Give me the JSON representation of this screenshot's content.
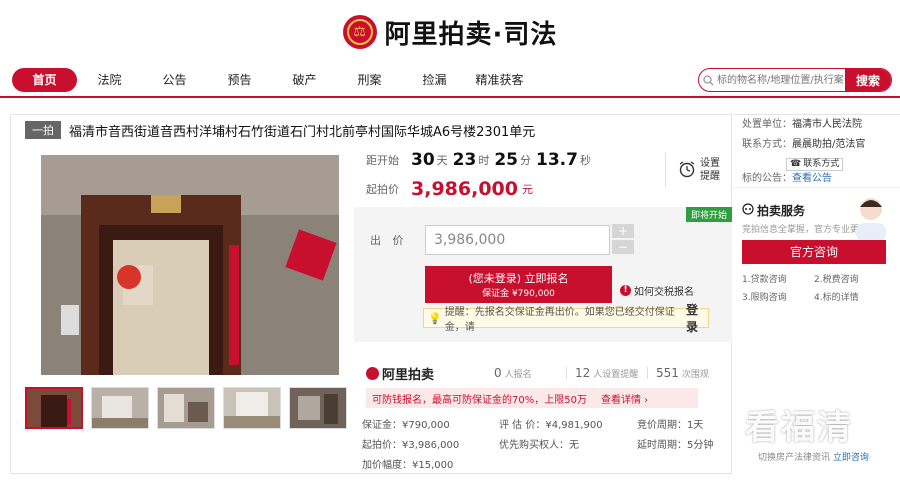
{
  "brand": {
    "name": "阿里拍卖·司法"
  },
  "nav": {
    "items": [
      "首页",
      "法院",
      "公告",
      "预告",
      "破产",
      "刑案",
      "捡漏",
      "精准获客"
    ],
    "active_index": 0
  },
  "search": {
    "placeholder": "标的物名称/地理位置/执行案号",
    "button": "搜索"
  },
  "lot": {
    "tag": "一拍",
    "title": "福清市音西街道音西村洋埔村石竹街道石门村北前亭村国际华城A6号楼2301单元",
    "countdown_label": "距开始",
    "countdown": {
      "days": "30",
      "days_unit": "天",
      "hours": "23",
      "hours_unit": "时",
      "minutes": "25",
      "minutes_unit": "分",
      "seconds": "13.7",
      "seconds_unit": "秒"
    },
    "start_price_label": "起拍价",
    "start_price": "3,986,000",
    "price_unit": "元",
    "remind": "设置提醒",
    "soon_badge": "即将开始",
    "bid_label": "出 价",
    "bid_value": "3,986,000",
    "plus": "+",
    "minus": "−",
    "signup_main": "(您未登录) 立即报名",
    "signup_sub": "保证金 ¥790,000",
    "how_pay": "如何交税报名",
    "warn": "!",
    "tip_prefix": "提醒：先报名交保证金再出价。如果您已经交付保证金，请",
    "tip_login": "登录"
  },
  "stats": {
    "logo": "阿里拍卖",
    "signup_count": "0",
    "signup_label": "人报名",
    "remind_count": "12",
    "remind_label": "人设置提醒",
    "view_count": "551",
    "view_label": "次围观"
  },
  "promo": {
    "text": "可防钱报名，最高可防保证金的70%，上限50万",
    "link": "查看详情 ›"
  },
  "details": [
    "保证金：¥790,000",
    "评 估 价：¥4,981,900",
    "竞价周期：1天",
    "起拍价：¥3,986,000",
    "优先购买权人：无",
    "延时周期：5分钟",
    "加价幅度：¥15,000",
    "",
    ""
  ],
  "side": {
    "unit_label": "处置单位：",
    "unit_value": "福清市人民法院",
    "contact_label": "联系方式：",
    "contact_value": "晨晨助拍/范法官",
    "contact_badge": "联系方式",
    "notice_label": "标的公告：",
    "notice_link": "查看公告",
    "service_title": "拍卖服务",
    "service_sub": "竞拍信息全掌握，官方专业更放心",
    "consult": "官方咨询",
    "faq": [
      "1.贷款咨询",
      "2.税费咨询",
      "3.限购咨询",
      "4.标的详情"
    ],
    "bottom_text": "切换房产法律资讯",
    "bottom_link": "立即咨询"
  },
  "watermark": "看福清"
}
